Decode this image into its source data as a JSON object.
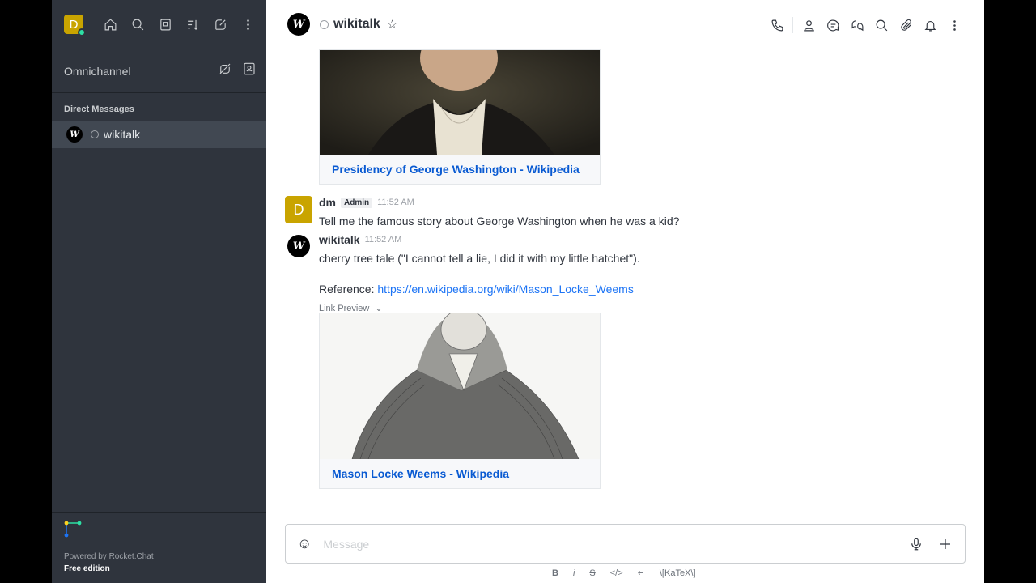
{
  "sidebar": {
    "user_initial": "D",
    "omnichannel_label": "Omnichannel",
    "direct_messages_header": "Direct Messages",
    "dm_items": [
      {
        "name": "wikitalk",
        "avatar_letter": "W"
      }
    ],
    "footer": {
      "powered_by": "Powered by Rocket.Chat",
      "edition": "Free edition"
    }
  },
  "header": {
    "room_name": "wikitalk",
    "avatar_letter": "W"
  },
  "messages": {
    "preview1": {
      "link_title": "Presidency of George Washington - Wikipedia"
    },
    "msg1": {
      "user": "dm",
      "avatar_letter": "D",
      "role": "Admin",
      "time": "11:52 AM",
      "text": "Tell me the famous story about George Washington when he was a kid?"
    },
    "msg2": {
      "user": "wikitalk",
      "avatar_letter": "W",
      "time": "11:52 AM",
      "text": "cherry tree tale (\"I cannot tell a lie, I did it with my little hatchet\").",
      "reference_label": "Reference: ",
      "reference_url": "https://en.wikipedia.org/wiki/Mason_Locke_Weems",
      "link_preview_label": "Link Preview",
      "preview_title": "Mason Locke Weems - Wikipedia"
    }
  },
  "composer": {
    "placeholder": "Message",
    "format_bar": [
      "B",
      "i",
      "S",
      "</>",
      "↵",
      "\\[KaTeX\\]"
    ]
  },
  "colors": {
    "sidebar_bg": "#2f343d",
    "accent": "#095ad2",
    "admin_avatar": "#c9a400"
  }
}
